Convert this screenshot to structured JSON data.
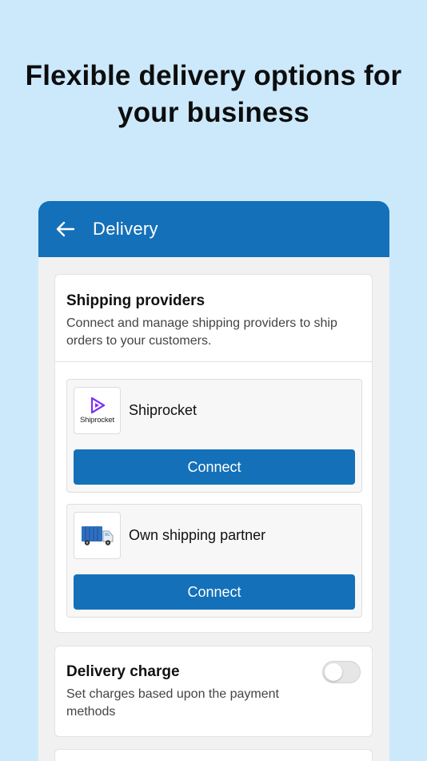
{
  "headline": {
    "line1": "Flexible delivery options for",
    "line2": "your business"
  },
  "appbar": {
    "title": "Delivery",
    "back_icon": "arrow-left-icon"
  },
  "shipping": {
    "title": "Shipping providers",
    "subtitle": "Connect and manage shipping providers to ship orders to your customers.",
    "providers": [
      {
        "name": "Shiprocket",
        "logo_text": "Shiprocket",
        "logo_icon": "shiprocket-logo-icon",
        "button_label": "Connect"
      },
      {
        "name": "Own shipping partner",
        "logo_icon": "delivery-truck-icon",
        "button_label": "Connect"
      }
    ]
  },
  "delivery_charge": {
    "title": "Delivery charge",
    "subtitle": "Set charges based upon the payment methods",
    "toggle_on": false
  },
  "colors": {
    "background": "#cce9fc",
    "primary": "#1470b8",
    "logo_purple": "#7b2ff7"
  }
}
